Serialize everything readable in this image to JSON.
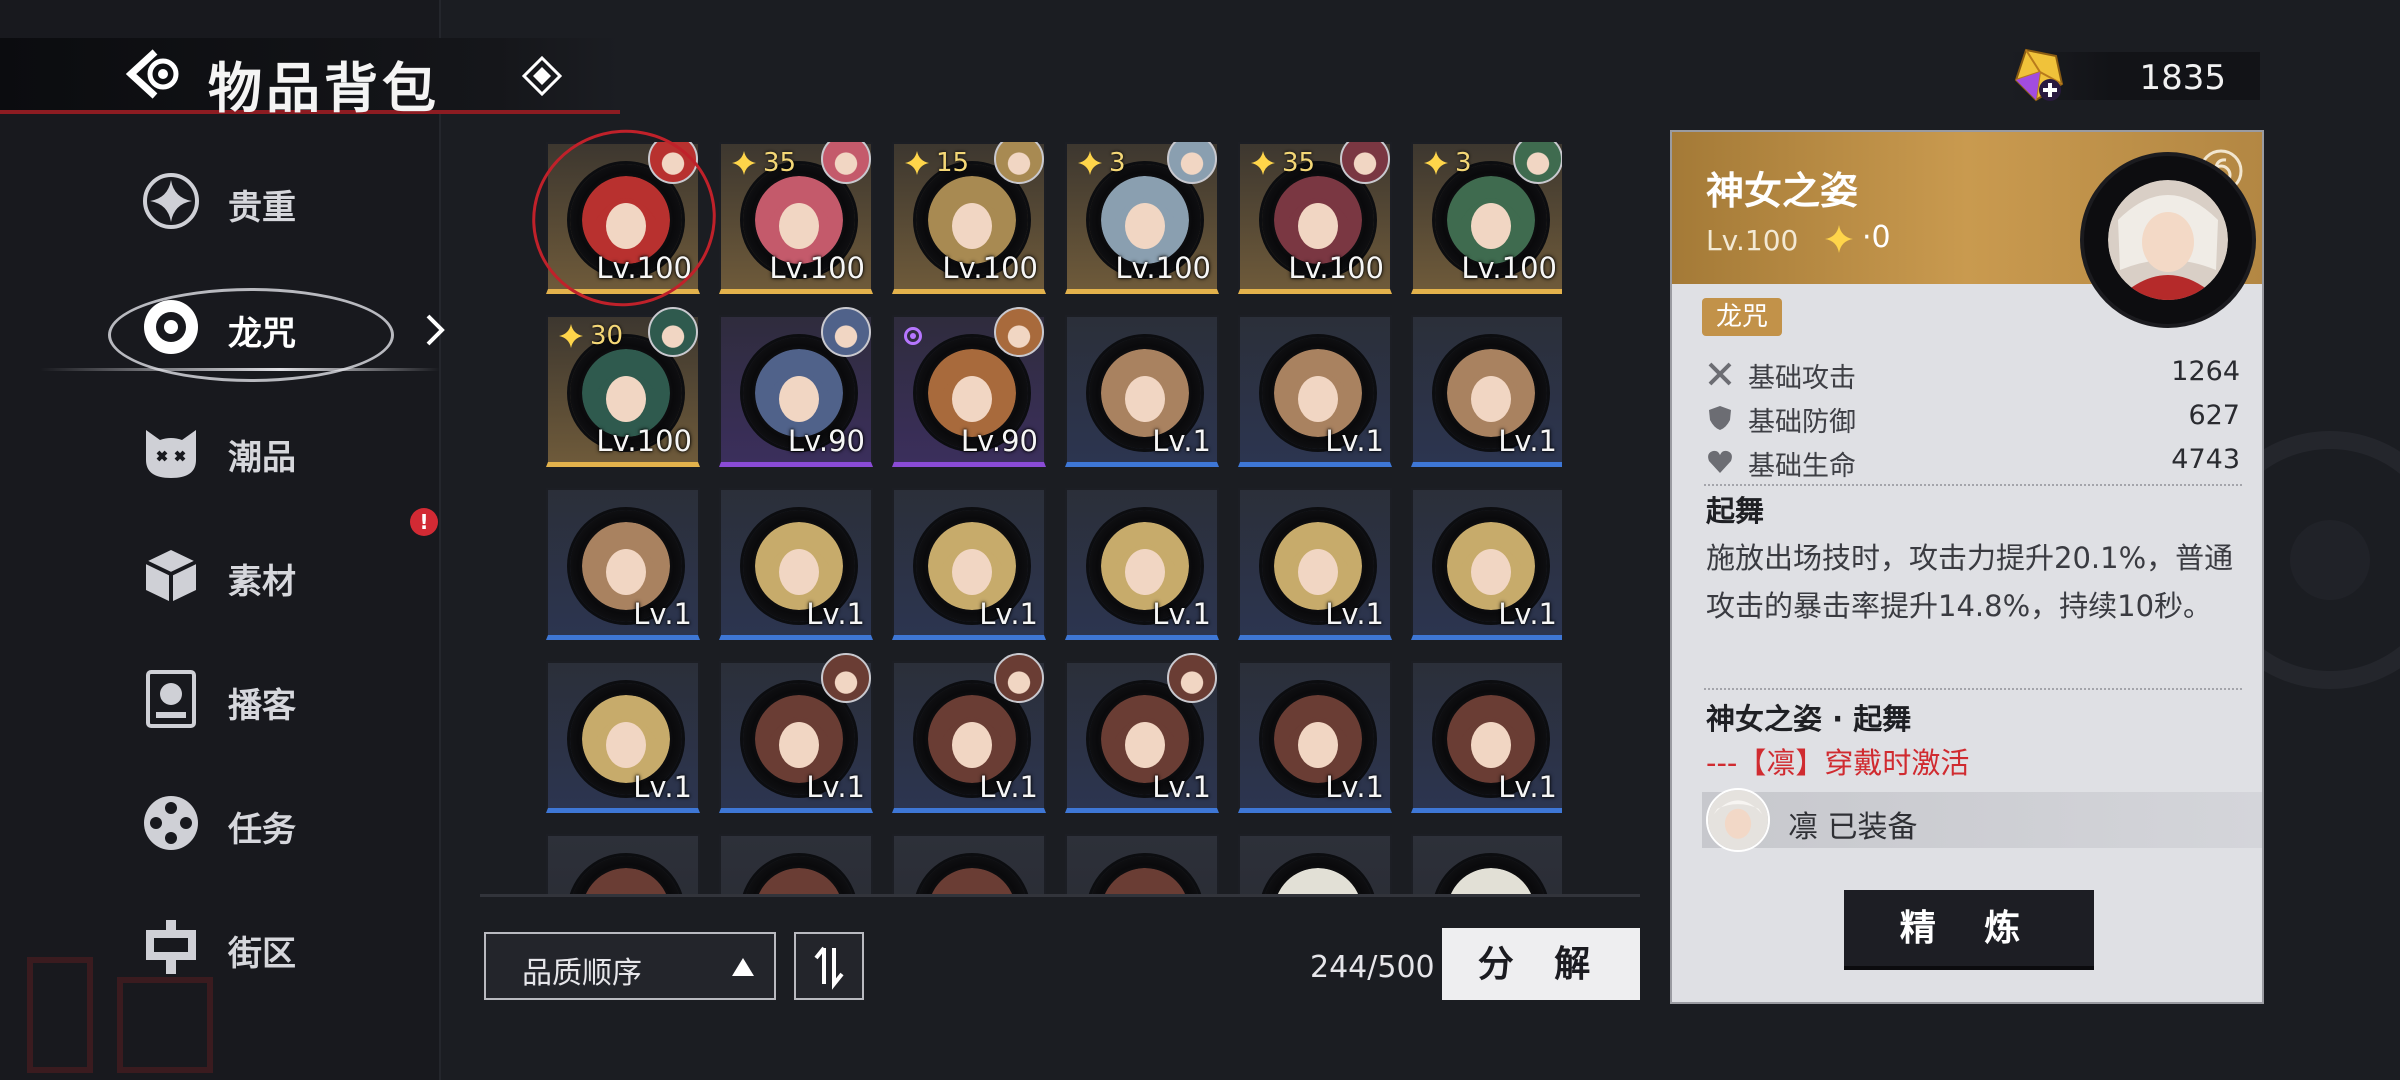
{
  "header": {
    "title": "物品背包"
  },
  "currency": {
    "value": "1835"
  },
  "sidebar": {
    "items": [
      {
        "label": "贵重",
        "icon": "sparkle-icon"
      },
      {
        "label": "龙咒",
        "icon": "disc-icon"
      },
      {
        "label": "潮品",
        "icon": "cat-face-icon"
      },
      {
        "label": "素材",
        "icon": "box-icon"
      },
      {
        "label": "播客",
        "icon": "podcast-icon"
      },
      {
        "label": "任务",
        "icon": "film-reel-icon"
      },
      {
        "label": "街区",
        "icon": "district-icon"
      }
    ],
    "notice": "!"
  },
  "grid": {
    "rows": [
      [
        {
          "lv": "Lv.100",
          "q": "gold",
          "badge": "",
          "owner": true,
          "c": "#b8312f"
        },
        {
          "lv": "Lv.100",
          "q": "gold",
          "badge": "35",
          "owner": true,
          "c": "#c45a6b"
        },
        {
          "lv": "Lv.100",
          "q": "gold",
          "badge": "15",
          "owner": true,
          "c": "#a88a52"
        },
        {
          "lv": "Lv.100",
          "q": "gold",
          "badge": "3",
          "owner": true,
          "c": "#8a9fb0"
        },
        {
          "lv": "Lv.100",
          "q": "gold",
          "badge": "35",
          "owner": true,
          "c": "#7a3742"
        },
        {
          "lv": "Lv.100",
          "q": "gold",
          "badge": "3",
          "owner": true,
          "c": "#3f6b4f"
        }
      ],
      [
        {
          "lv": "Lv.100",
          "q": "gold",
          "badge": "30",
          "owner": true,
          "c": "#2f5a4e"
        },
        {
          "lv": "Lv.90",
          "q": "purple",
          "badge": "",
          "owner": true,
          "c": "#50628a"
        },
        {
          "lv": "Lv.90",
          "q": "purple",
          "badge": "",
          "owner": true,
          "dot": true,
          "c": "#a86a3c"
        },
        {
          "lv": "Lv.1",
          "q": "blue",
          "badge": "",
          "owner": false,
          "c": "#a98260"
        },
        {
          "lv": "Lv.1",
          "q": "blue",
          "badge": "",
          "owner": false,
          "c": "#a98260"
        },
        {
          "lv": "Lv.1",
          "q": "blue",
          "badge": "",
          "owner": false,
          "c": "#a98260"
        }
      ],
      [
        {
          "lv": "Lv.1",
          "q": "blue",
          "badge": "",
          "owner": false,
          "c": "#a98260"
        },
        {
          "lv": "Lv.1",
          "q": "blue",
          "badge": "",
          "owner": false,
          "c": "#c7ab6b"
        },
        {
          "lv": "Lv.1",
          "q": "blue",
          "badge": "",
          "owner": false,
          "c": "#c7ab6b"
        },
        {
          "lv": "Lv.1",
          "q": "blue",
          "badge": "",
          "owner": false,
          "c": "#c7ab6b"
        },
        {
          "lv": "Lv.1",
          "q": "blue",
          "badge": "",
          "owner": false,
          "c": "#c7ab6b"
        },
        {
          "lv": "Lv.1",
          "q": "blue",
          "badge": "",
          "owner": false,
          "c": "#c7ab6b"
        }
      ],
      [
        {
          "lv": "Lv.1",
          "q": "blue",
          "badge": "",
          "owner": false,
          "c": "#c7ab6b"
        },
        {
          "lv": "Lv.1",
          "q": "blue",
          "badge": "",
          "owner": true,
          "c": "#6a3d34"
        },
        {
          "lv": "Lv.1",
          "q": "blue",
          "badge": "",
          "owner": true,
          "c": "#6a3d34"
        },
        {
          "lv": "Lv.1",
          "q": "blue",
          "badge": "",
          "owner": true,
          "c": "#6a3d34"
        },
        {
          "lv": "Lv.1",
          "q": "blue",
          "badge": "",
          "owner": false,
          "c": "#6a3d34"
        },
        {
          "lv": "Lv.1",
          "q": "blue",
          "badge": "",
          "owner": false,
          "c": "#6a3d34"
        }
      ],
      [
        {
          "lv": "",
          "q": "none",
          "badge": "",
          "owner": false,
          "c": "#6a3d34"
        },
        {
          "lv": "",
          "q": "none",
          "badge": "",
          "owner": false,
          "c": "#6a3d34"
        },
        {
          "lv": "",
          "q": "none",
          "badge": "",
          "owner": false,
          "c": "#6a3d34"
        },
        {
          "lv": "",
          "q": "none",
          "badge": "",
          "owner": false,
          "c": "#6a3d34"
        },
        {
          "lv": "",
          "q": "none",
          "badge": "",
          "owner": false,
          "c": "#e2e0d6"
        },
        {
          "lv": "",
          "q": "none",
          "badge": "",
          "owner": false,
          "c": "#e2e0d6"
        }
      ]
    ]
  },
  "bottom": {
    "sort_label": "品质顺序",
    "count": "244/500",
    "decompose_label": "分 解"
  },
  "detail": {
    "name": "神女之姿",
    "level": "Lv.100",
    "stars": "·0",
    "tag": "龙咒",
    "stats": [
      {
        "label": "基础攻击",
        "value": "1264",
        "icon": "crossed-swords-icon"
      },
      {
        "label": "基础防御",
        "value": "627",
        "icon": "shield-icon"
      },
      {
        "label": "基础生命",
        "value": "4743",
        "icon": "heart-icon"
      }
    ],
    "skill_name": "起舞",
    "skill_desc": "施放出场技时，攻击力提升20.1%，普通攻击的暴击率提升14.8%，持续10秒。",
    "set_name": "神女之姿 · 起舞",
    "set_condition": "---【凛】穿戴时激活",
    "equipped_text": "凛 已装备",
    "refine_label": "精 炼"
  }
}
